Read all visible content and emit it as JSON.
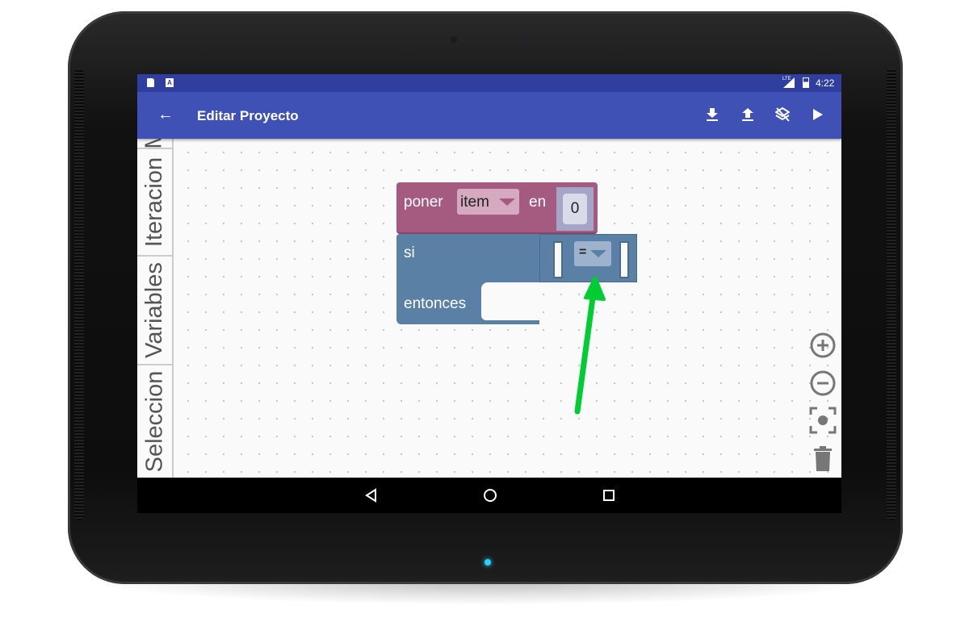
{
  "status_bar": {
    "time": "4:22",
    "network": "LTE"
  },
  "toolbar": {
    "title": "Editar Proyecto",
    "back_icon": "arrow-left-icon",
    "actions": [
      "download-icon",
      "upload-icon",
      "clear-icon",
      "play-icon"
    ]
  },
  "sidebar": {
    "tabs": [
      {
        "label": "M"
      },
      {
        "label": "Iteracion"
      },
      {
        "label": "Variables"
      },
      {
        "label": "Seleccion"
      }
    ]
  },
  "blocks": {
    "set_block": {
      "label": "poner",
      "variable": "item",
      "en": "en",
      "value": "0",
      "color": "#a55b80"
    },
    "if_block": {
      "si": "si",
      "entonces": "entonces",
      "operator": "=",
      "color": "#5b80a5"
    }
  },
  "annotation": {
    "arrow_color": "#00cc33"
  },
  "colors": {
    "status": "#303f9f",
    "toolbar": "#3f51b5"
  }
}
